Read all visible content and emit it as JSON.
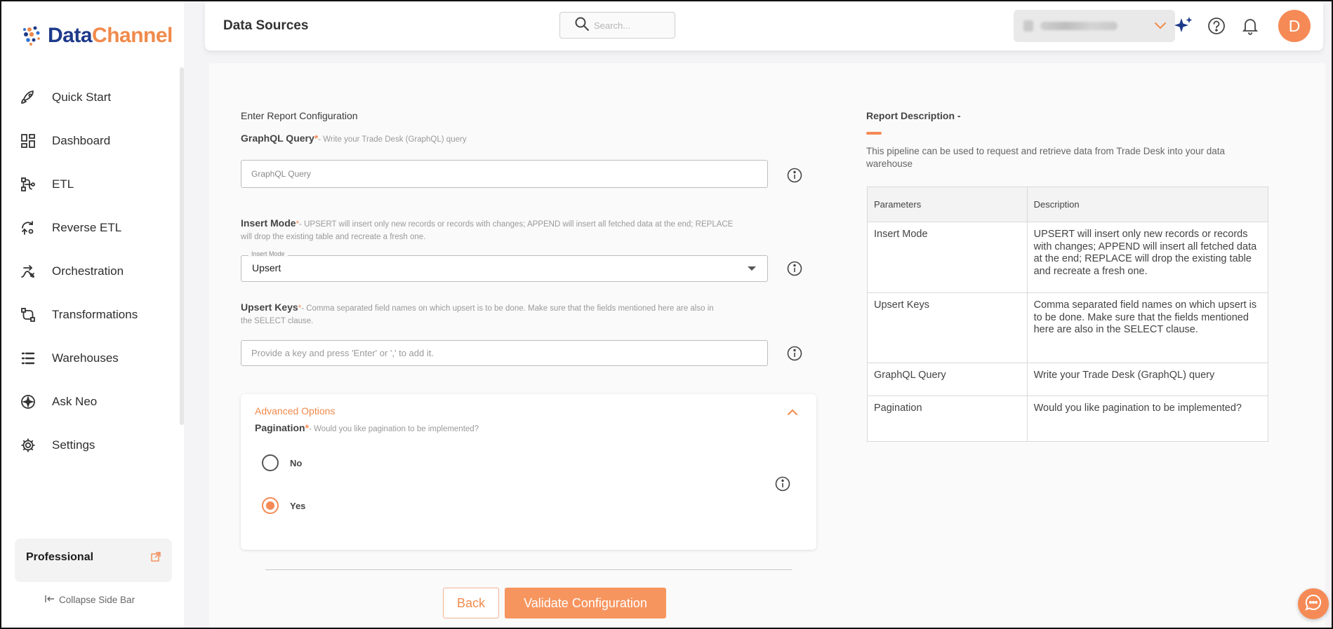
{
  "brand": {
    "name_part1": "Data",
    "name_part2": "Channel",
    "accent": "#f58a56",
    "primary": "#1e3a8a"
  },
  "sidebar": {
    "items": [
      {
        "label": "Quick Start",
        "icon": "rocket-icon"
      },
      {
        "label": "Dashboard",
        "icon": "dashboard-grid-icon"
      },
      {
        "label": "ETL",
        "icon": "etl-flow-icon"
      },
      {
        "label": "Reverse ETL",
        "icon": "reverse-etl-icon"
      },
      {
        "label": "Orchestration",
        "icon": "orchestration-icon"
      },
      {
        "label": "Transformations",
        "icon": "transformations-icon"
      },
      {
        "label": "Warehouses",
        "icon": "warehouses-icon"
      },
      {
        "label": "Ask Neo",
        "icon": "sparkle-icon"
      },
      {
        "label": "Settings",
        "icon": "gear-icon"
      }
    ],
    "plan": "Professional",
    "collapse_label": "Collapse Side Bar"
  },
  "header": {
    "title": "Data Sources",
    "search_placeholder": "Search...",
    "avatar_initial": "D"
  },
  "form": {
    "section_title": "Enter Report Configuration",
    "graphql": {
      "label": "GraphQL Query",
      "help": "- Write your Trade Desk (GraphQL) query",
      "placeholder": "GraphQL Query"
    },
    "insert_mode": {
      "label": "Insert Mode",
      "help": "- UPSERT will insert only new records or records with changes; APPEND will insert all fetched data at the end; REPLACE will drop the existing table and recreate a fresh one.",
      "legend": "Insert Mode",
      "value": "Upsert"
    },
    "upsert_keys": {
      "label": "Upsert Keys",
      "help": "- Comma separated field names on which upsert is to be done. Make sure that the fields mentioned here are also in the SELECT clause.",
      "placeholder": "Provide a key and press 'Enter' or ',' to add it."
    },
    "advanced": {
      "title": "Advanced Options",
      "pagination_label": "Pagination",
      "pagination_help": "- Would you like pagination to be implemented?",
      "options": [
        {
          "label": "No",
          "selected": false
        },
        {
          "label": "Yes",
          "selected": true
        }
      ]
    },
    "back_label": "Back",
    "validate_label": "Validate Configuration"
  },
  "report": {
    "title": "Report Description -",
    "description": "This pipeline can be used to request and retrieve data from Trade Desk into your data warehouse",
    "table_headers": [
      "Parameters",
      "Description"
    ],
    "rows": [
      {
        "param": "Insert Mode",
        "desc": "UPSERT will insert only new records or records with changes; APPEND will insert all fetched data at the end; REPLACE will drop the existing table and recreate a fresh one."
      },
      {
        "param": "Upsert Keys",
        "desc": "Comma separated field names on which upsert is to be done. Make sure that the fields mentioned here are also in the SELECT clause."
      },
      {
        "param": "GraphQL Query",
        "desc": "Write your Trade Desk (GraphQL) query"
      },
      {
        "param": "Pagination",
        "desc": "Would you like pagination to be implemented?"
      }
    ]
  }
}
